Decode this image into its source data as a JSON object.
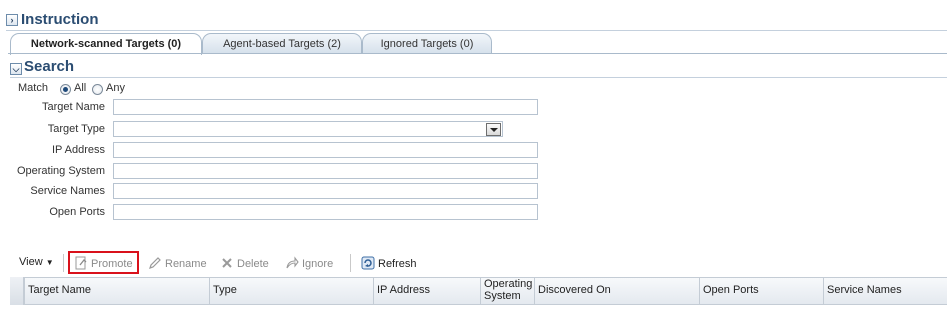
{
  "instruction": {
    "title": "Instruction"
  },
  "tabs": [
    {
      "label": "Network-scanned Targets (0)",
      "active": true
    },
    {
      "label": "Agent-based Targets (2)",
      "active": false
    },
    {
      "label": "Ignored Targets (0)",
      "active": false
    }
  ],
  "search": {
    "title": "Search",
    "match_label": "Match",
    "match_options": [
      "All",
      "Any"
    ],
    "match_selected": "All",
    "fields": {
      "target_name": {
        "label": "Target Name",
        "value": ""
      },
      "target_type": {
        "label": "Target Type",
        "value": ""
      },
      "ip_address": {
        "label": "IP Address",
        "value": ""
      },
      "operating_system": {
        "label": "Operating System",
        "value": ""
      },
      "service_names": {
        "label": "Service Names",
        "value": ""
      },
      "open_ports": {
        "label": "Open Ports",
        "value": ""
      }
    }
  },
  "toolbar": {
    "view": "View",
    "promote": "Promote",
    "rename": "Rename",
    "delete": "Delete",
    "ignore": "Ignore",
    "refresh": "Refresh"
  },
  "table": {
    "columns": {
      "target_name": "Target Name",
      "type": "Type",
      "ip_address": "IP Address",
      "operating_system_1": "Operating",
      "operating_system_2": "System",
      "discovered_on": "Discovered On",
      "open_ports": "Open Ports",
      "service_names": "Service Names"
    },
    "rows": []
  },
  "colors": {
    "accent": "#2b4d72",
    "highlight": "#d9111b"
  }
}
